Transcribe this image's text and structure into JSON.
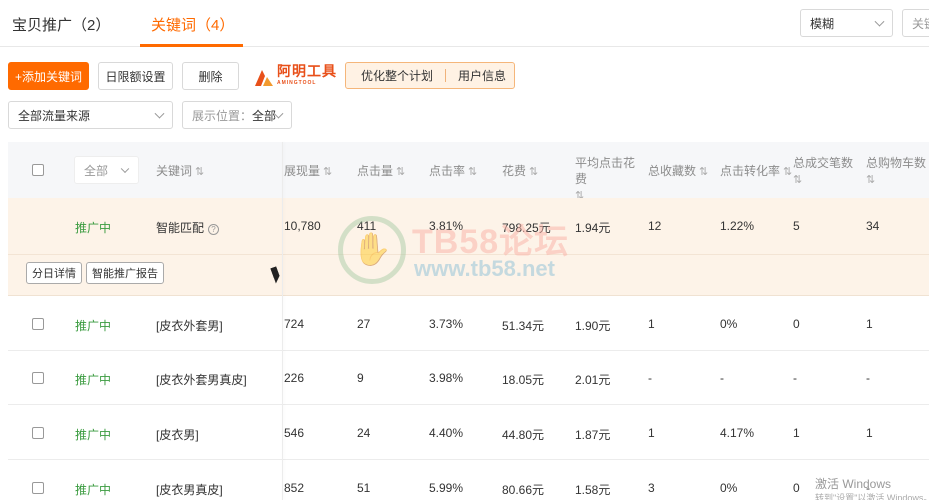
{
  "tabs": [
    {
      "label": "宝贝推广（2）"
    },
    {
      "label": "关键词（4）"
    }
  ],
  "top_right": {
    "match_select": "模糊",
    "keyword_search": "关键"
  },
  "toolbar": {
    "add_keyword": "+添加关键词",
    "daily_limit": "日限额设置",
    "delete": "删除",
    "brand_name": "阿明工具",
    "brand_sub": "AMINGTOOL",
    "optimize_plan": "优化整个计划",
    "user_info": "用户信息"
  },
  "filters": {
    "traffic_source": "全部流量来源",
    "position_label": "展示位置：",
    "position_value": "全部"
  },
  "table": {
    "header_filter": "全部",
    "columns": [
      "关键词",
      "展现量",
      "点击量",
      "点击率",
      "花费",
      "平均点击花费",
      "总收藏数",
      "点击转化率",
      "总成交笔数",
      "总购物车数"
    ],
    "rows": [
      {
        "status": "推广中",
        "keyword": "智能匹配",
        "impressions": "10,780",
        "clicks": "411",
        "ctr": "3.81%",
        "cost": "798.25元",
        "cpc": "1.94元",
        "favorites": "12",
        "cvr": "1.22%",
        "orders": "5",
        "carts": "34"
      },
      {
        "status": "推广中",
        "keyword": "[皮衣外套男]",
        "impressions": "724",
        "clicks": "27",
        "ctr": "3.73%",
        "cost": "51.34元",
        "cpc": "1.90元",
        "favorites": "1",
        "cvr": "0%",
        "orders": "0",
        "carts": "1"
      },
      {
        "status": "推广中",
        "keyword": "[皮衣外套男真皮]",
        "impressions": "226",
        "clicks": "9",
        "ctr": "3.98%",
        "cost": "18.05元",
        "cpc": "2.01元",
        "favorites": "-",
        "cvr": "-",
        "orders": "-",
        "carts": "-"
      },
      {
        "status": "推广中",
        "keyword": "[皮衣男]",
        "impressions": "546",
        "clicks": "24",
        "ctr": "4.40%",
        "cost": "44.80元",
        "cpc": "1.87元",
        "favorites": "1",
        "cvr": "4.17%",
        "orders": "1",
        "carts": "1"
      },
      {
        "status": "推广中",
        "keyword": "[皮衣男真皮]",
        "impressions": "852",
        "clicks": "51",
        "ctr": "5.99%",
        "cost": "80.66元",
        "cpc": "1.58元",
        "favorites": "3",
        "cvr": "0%",
        "orders": "0",
        "carts": "-"
      }
    ],
    "sub_actions": {
      "daily_detail": "分日详情",
      "smart_report": "智能推广报告"
    }
  },
  "watermark": {
    "title": "TB58论坛",
    "url": "www.tb58.net"
  },
  "windows": {
    "line1": "激活 Windows",
    "line2": "转到\"设置\"以激活 Windows。"
  }
}
